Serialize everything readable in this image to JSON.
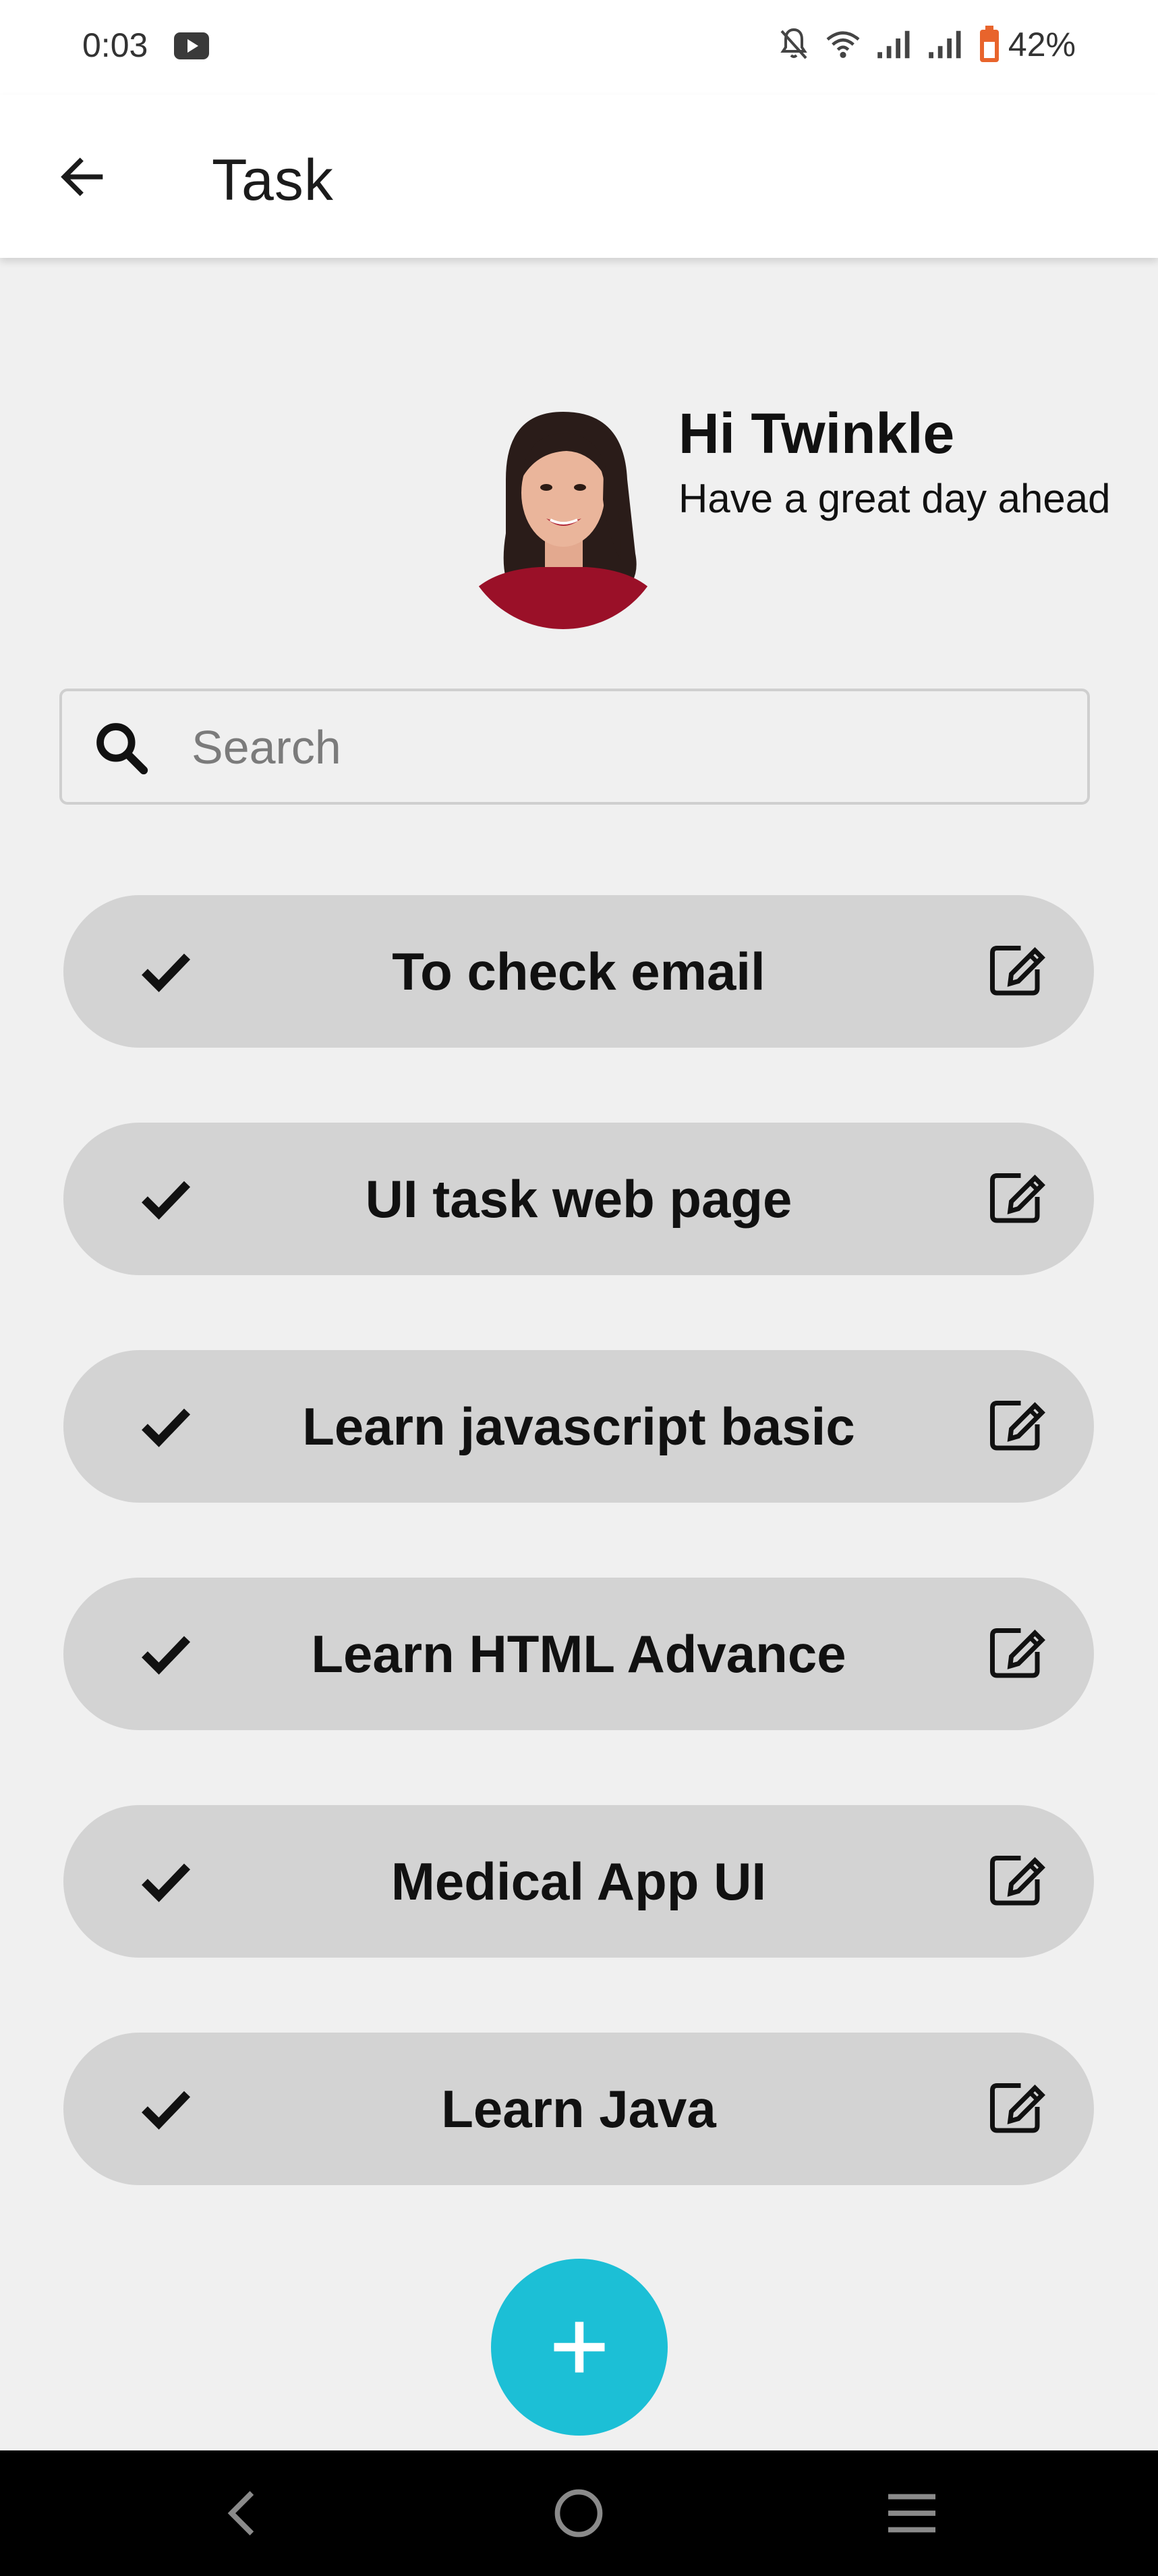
{
  "status_bar": {
    "time": "0:03",
    "battery_percent": "42%",
    "icons": [
      "youtube-icon",
      "bell-off-icon",
      "wifi-icon",
      "signal-icon",
      "signal-icon",
      "battery-icon"
    ]
  },
  "app_bar": {
    "title": "Task",
    "back_icon": "arrow-left-icon"
  },
  "profile": {
    "greeting": "Hi Twinkle",
    "subtitle": "Have a great day ahead"
  },
  "search": {
    "placeholder": "Search",
    "value": ""
  },
  "tasks": [
    {
      "label": "To check email"
    },
    {
      "label": "UI task web page"
    },
    {
      "label": "Learn javascript basic"
    },
    {
      "label": "Learn HTML Advance"
    },
    {
      "label": "Medical App UI"
    },
    {
      "label": "Learn Java"
    }
  ],
  "fab": {
    "icon": "plus-icon"
  },
  "colors": {
    "accent": "#1cbfd6",
    "task_pill": "#d3d3d3",
    "background": "#f0f0f0",
    "battery": "#e8642c"
  }
}
